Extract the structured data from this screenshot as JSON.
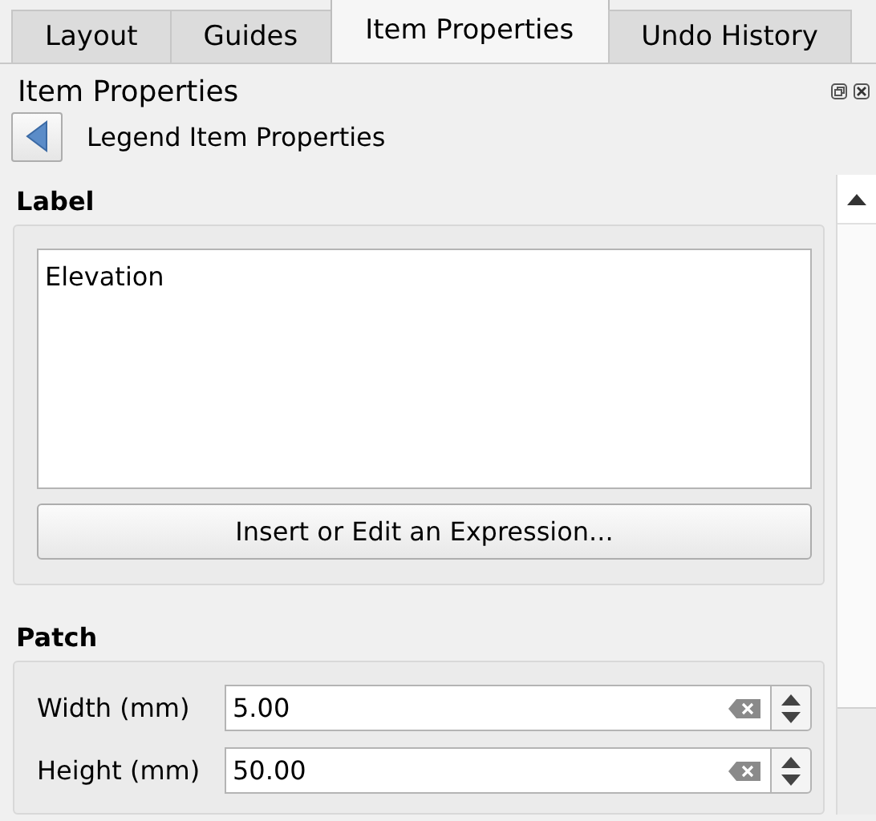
{
  "tabs": [
    {
      "label": "Layout",
      "selected": false
    },
    {
      "label": "Guides",
      "selected": false
    },
    {
      "label": "Item Properties",
      "selected": true
    },
    {
      "label": "Undo History",
      "selected": false
    }
  ],
  "panel": {
    "title": "Item Properties",
    "subtitle": "Legend Item Properties"
  },
  "label_section": {
    "heading": "Label",
    "text": "Elevation",
    "button": "Insert or Edit an Expression..."
  },
  "patch_section": {
    "heading": "Patch",
    "fields": [
      {
        "label": "Width (mm)",
        "value": "5.00"
      },
      {
        "label": "Height (mm)",
        "value": "50.00"
      }
    ]
  }
}
